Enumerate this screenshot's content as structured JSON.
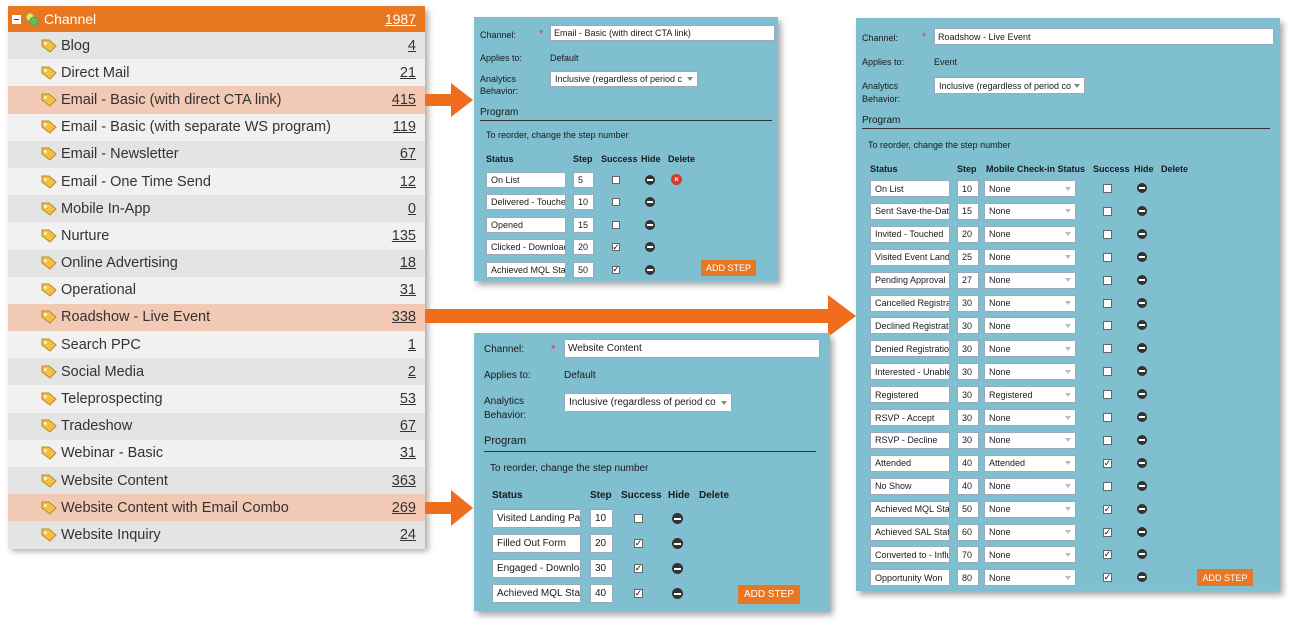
{
  "channel_list": {
    "title": "Channel",
    "total": "1987",
    "items": [
      {
        "name": "Blog",
        "count": "4"
      },
      {
        "name": "Direct Mail",
        "count": "21"
      },
      {
        "name": "Email - Basic (with direct CTA link)",
        "count": "415"
      },
      {
        "name": "Email - Basic (with separate WS program)",
        "count": "119"
      },
      {
        "name": "Email - Newsletter",
        "count": "67"
      },
      {
        "name": "Email - One Time Send",
        "count": "12"
      },
      {
        "name": "Mobile In-App",
        "count": "0"
      },
      {
        "name": "Nurture",
        "count": "135"
      },
      {
        "name": "Online Advertising",
        "count": "18"
      },
      {
        "name": "Operational",
        "count": "31"
      },
      {
        "name": "Roadshow - Live Event",
        "count": "338"
      },
      {
        "name": "Search PPC",
        "count": "1"
      },
      {
        "name": "Social Media",
        "count": "2"
      },
      {
        "name": "Teleprospecting",
        "count": "53"
      },
      {
        "name": "Tradeshow",
        "count": "67"
      },
      {
        "name": "Webinar - Basic",
        "count": "31"
      },
      {
        "name": "Website Content",
        "count": "363"
      },
      {
        "name": "Website Content with Email Combo",
        "count": "269"
      },
      {
        "name": "Website Inquiry",
        "count": "24"
      }
    ]
  },
  "panel_email": {
    "channel_label": "Channel:",
    "channel_value": "Email - Basic (with direct CTA link)",
    "applies_label": "Applies to:",
    "applies_value": "Default",
    "analytics_label_1": "Analytics",
    "analytics_label_2": "Behavior:",
    "analytics_value": "Inclusive (regardless of period c",
    "program_label": "Program",
    "reorder_text": "To reorder, change the step number",
    "headers": {
      "status": "Status",
      "step": "Step",
      "success": "Success",
      "hide": "Hide",
      "delete": "Delete"
    },
    "steps": [
      {
        "status": "On List",
        "step": "5",
        "success": false
      },
      {
        "status": "Delivered - Touched",
        "step": "10",
        "success": false
      },
      {
        "status": "Opened",
        "step": "15",
        "success": false
      },
      {
        "status": "Clicked - Download",
        "step": "20",
        "success": true
      },
      {
        "status": "Achieved MQL Status",
        "step": "50",
        "success": true
      }
    ],
    "add_step": "ADD STEP"
  },
  "panel_website": {
    "channel_label": "Channel:",
    "channel_value": "Website Content",
    "applies_label": "Applies to:",
    "applies_value": "Default",
    "analytics_label_1": "Analytics",
    "analytics_label_2": "Behavior:",
    "analytics_value": "Inclusive (regardless of period co",
    "program_label": "Program",
    "reorder_text": "To reorder, change the step number",
    "headers": {
      "status": "Status",
      "step": "Step",
      "success": "Success",
      "hide": "Hide",
      "delete": "Delete"
    },
    "steps": [
      {
        "status": "Visited Landing Page",
        "step": "10",
        "success": false
      },
      {
        "status": "Filled Out Form",
        "step": "20",
        "success": true
      },
      {
        "status": "Engaged - Download",
        "step": "30",
        "success": true
      },
      {
        "status": "Achieved MQL Status",
        "step": "40",
        "success": true
      }
    ],
    "add_step": "ADD STEP"
  },
  "panel_roadshow": {
    "channel_label": "Channel:",
    "channel_value": "Roadshow - Live Event",
    "applies_label": "Applies to:",
    "applies_value": "Event",
    "analytics_label_1": "Analytics",
    "analytics_label_2": "Behavior:",
    "analytics_value": "Inclusive (regardless of period co",
    "program_label": "Program",
    "reorder_text": "To reorder, change the step number",
    "headers": {
      "status": "Status",
      "step": "Step",
      "mobile": "Mobile Check-in Status",
      "success": "Success",
      "hide": "Hide",
      "delete": "Delete"
    },
    "steps": [
      {
        "status": "On List",
        "step": "10",
        "mobile": "None",
        "success": false
      },
      {
        "status": "Sent Save-the-Date",
        "step": "15",
        "mobile": "None",
        "success": false
      },
      {
        "status": "Invited - Touched",
        "step": "20",
        "mobile": "None",
        "success": false
      },
      {
        "status": "Visited Event Landing",
        "step": "25",
        "mobile": "None",
        "success": false
      },
      {
        "status": "Pending Approval",
        "step": "27",
        "mobile": "None",
        "success": false
      },
      {
        "status": "Cancelled Registration",
        "step": "30",
        "mobile": "None",
        "success": false
      },
      {
        "status": "Declined Registration",
        "step": "30",
        "mobile": "None",
        "success": false
      },
      {
        "status": "Denied Registration",
        "step": "30",
        "mobile": "None",
        "success": false
      },
      {
        "status": "Interested - Unable",
        "step": "30",
        "mobile": "None",
        "success": false
      },
      {
        "status": "Registered",
        "step": "30",
        "mobile": "Registered",
        "success": false
      },
      {
        "status": "RSVP - Accept",
        "step": "30",
        "mobile": "None",
        "success": false
      },
      {
        "status": "RSVP - Decline",
        "step": "30",
        "mobile": "None",
        "success": false
      },
      {
        "status": "Attended",
        "step": "40",
        "mobile": "Attended",
        "success": true
      },
      {
        "status": "No Show",
        "step": "40",
        "mobile": "None",
        "success": false
      },
      {
        "status": "Achieved MQL Status",
        "step": "50",
        "mobile": "None",
        "success": true
      },
      {
        "status": "Achieved SAL Status",
        "step": "60",
        "mobile": "None",
        "success": true
      },
      {
        "status": "Converted to - Influenced",
        "step": "70",
        "mobile": "None",
        "success": true
      },
      {
        "status": "Opportunity Won",
        "step": "80",
        "mobile": "None",
        "success": true
      }
    ],
    "add_step": "ADD STEP"
  },
  "colors": {
    "accent": "#e87722",
    "panel": "#7fbfcf",
    "highlight": "#f1c9b4"
  },
  "icons": {
    "tag": "tag-icon",
    "tree": "channel-tree-icon",
    "hide": "hide-minus-icon",
    "delete": "delete-x-icon"
  }
}
